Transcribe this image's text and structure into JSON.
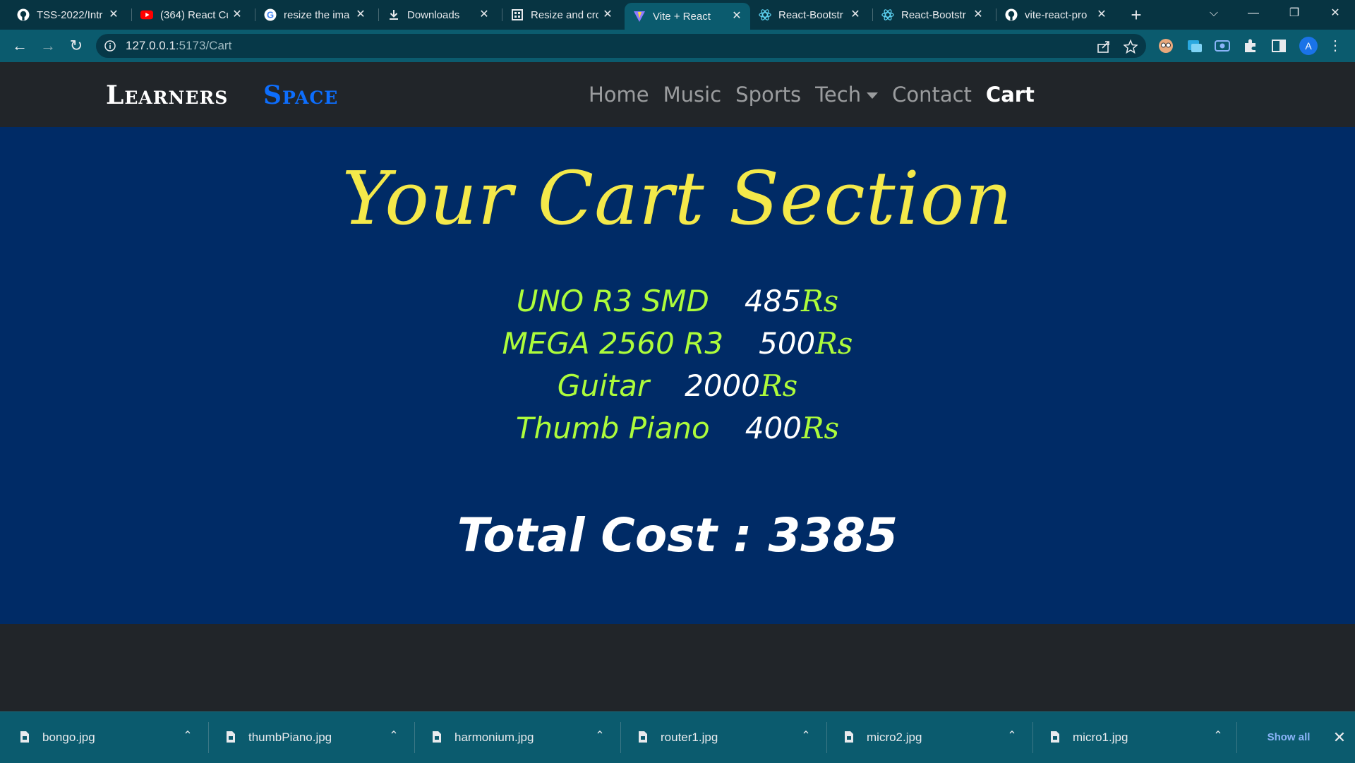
{
  "browser": {
    "tabs": [
      {
        "title": "TSS-2022/Intr",
        "icon": "github-icon"
      },
      {
        "title": "(364) React Cu",
        "icon": "youtube-icon"
      },
      {
        "title": "resize the ima",
        "icon": "google-icon"
      },
      {
        "title": "Downloads",
        "icon": "download-icon"
      },
      {
        "title": "Resize and cro",
        "icon": "crop-icon"
      },
      {
        "title": "Vite + React",
        "icon": "vite-icon",
        "active": true
      },
      {
        "title": "React-Bootstr",
        "icon": "react-bootstrap-icon"
      },
      {
        "title": "React-Bootstr",
        "icon": "react-bootstrap-icon"
      },
      {
        "title": "vite-react-pro",
        "icon": "github-icon"
      }
    ],
    "url_host": "127.0.0.1",
    "url_path": ":5173/Cart",
    "profile_initial": "A"
  },
  "site": {
    "brand_first": "Learners",
    "brand_second": "Space",
    "nav": {
      "home": "Home",
      "music": "Music",
      "sports": "Sports",
      "tech": "Tech",
      "contact": "Contact",
      "cart": "Cart"
    }
  },
  "cart": {
    "title": "Your Cart Section",
    "currency": "Rs",
    "items": [
      {
        "name": "UNO R3 SMD",
        "price": "485"
      },
      {
        "name": "MEGA 2560 R3",
        "price": "500"
      },
      {
        "name": "Guitar",
        "price": "2000"
      },
      {
        "name": "Thumb Piano",
        "price": "400"
      }
    ],
    "total_label": "Total Cost : 3385"
  },
  "downloads": {
    "files": [
      "bongo.jpg",
      "thumbPiano.jpg",
      "harmonium.jpg",
      "router1.jpg",
      "micro2.jpg",
      "micro1.jpg"
    ],
    "show_all": "Show all"
  },
  "colors": {
    "navbar": "#212529",
    "cart_bg": "#002b66",
    "title": "#f4e94a",
    "item_name": "#adfc3b",
    "brand_accent": "#0d6efd",
    "browser_frame": "#0b5b6e"
  }
}
